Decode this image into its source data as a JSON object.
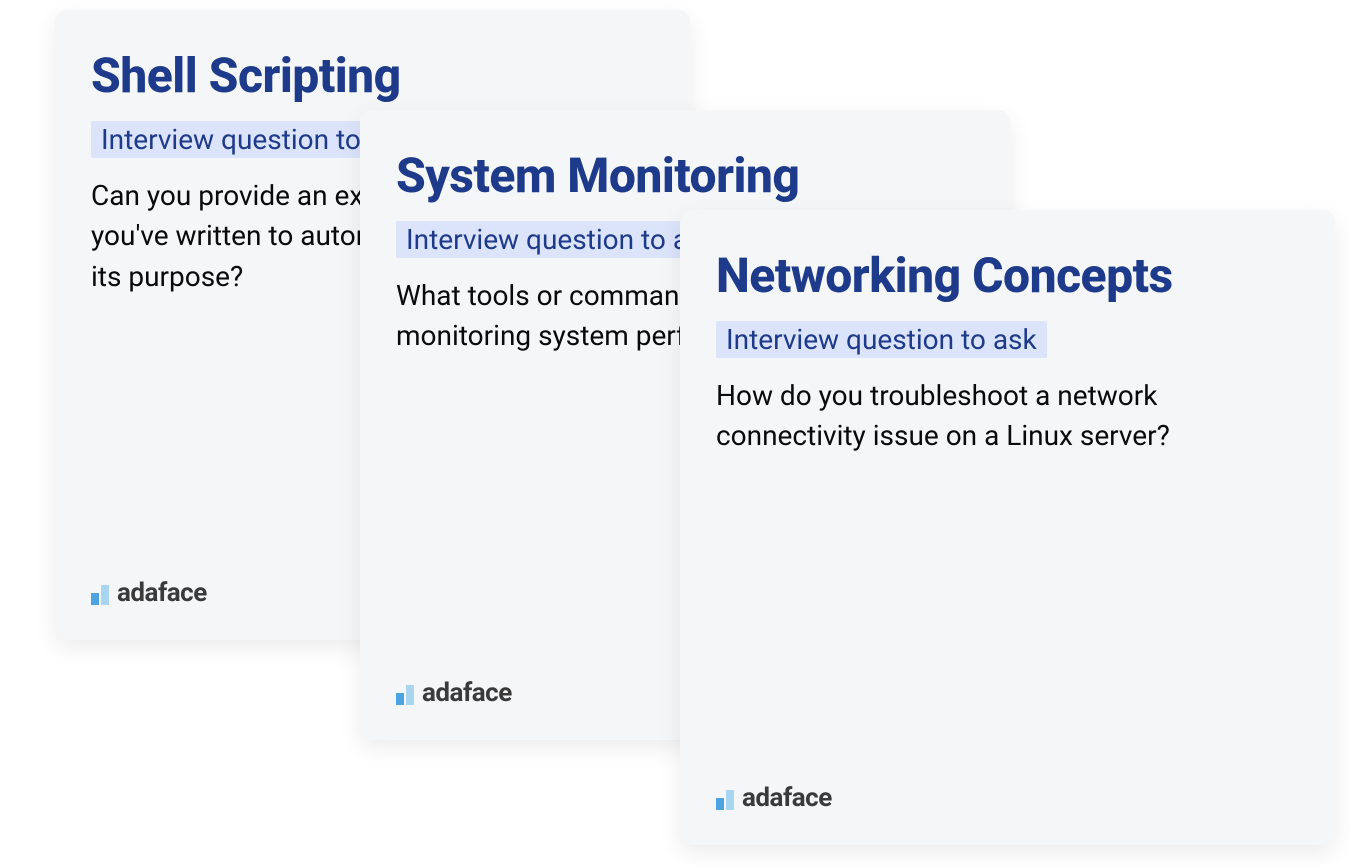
{
  "cards": [
    {
      "title": "Shell Scripting",
      "subtitle": "Interview question to ask",
      "question": "Can you provide an example of a shell script you've written to automate a task? What was its purpose?",
      "brand": "adaface"
    },
    {
      "title": "System Monitoring",
      "subtitle": "Interview question to ask",
      "question": "What tools or commands do you prefer for monitoring system performance in Linux?",
      "brand": "adaface"
    },
    {
      "title": "Networking Concepts",
      "subtitle": "Interview question to ask",
      "question": "How do you troubleshoot a network connectivity issue on a Linux server?",
      "brand": "adaface"
    }
  ]
}
